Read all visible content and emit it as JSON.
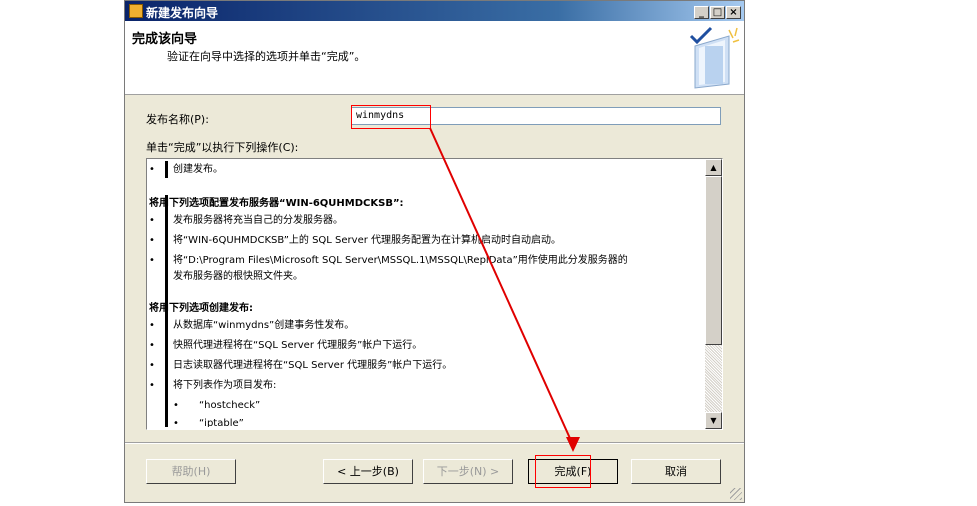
{
  "window": {
    "title": "新建发布向导",
    "controls": {
      "minimize": "_",
      "maximize": "□",
      "close": "×"
    }
  },
  "header": {
    "title": "完成该向导",
    "subtitle": "验证在向导中选择的选项并单击“完成”。"
  },
  "publication_name": {
    "label": "发布名称(P):",
    "value": "winmydns"
  },
  "actions_label": "单击“完成”以执行下列操作(C):",
  "summary": {
    "create_bullet": "•",
    "create": "创建发布。",
    "config_heading": "将用下列选项配置发布服务器“WIN-6QUHMDCKSB”:",
    "config_items": [
      "发布服务器将充当自己的分发服务器。",
      "将“WIN-6QUHMDCKSB”上的 SQL Server 代理服务配置为在计算机启动时自动启动。",
      "将“D:\\Program Files\\Microsoft SQL Server\\MSSQL.1\\MSSQL\\ReplData”用作使用此分发服务器的",
      "发布服务器的根快照文件夹。"
    ],
    "create_heading": "将用下列选项创建发布:",
    "create_items": [
      "从数据库“winmydns”创建事务性发布。",
      "快照代理进程将在“SQL Server 代理服务”帐户下运行。",
      "日志读取器代理进程将在“SQL Server 代理服务”帐户下运行。",
      "将下列表作为项目发布:"
    ],
    "tables": [
      "“hostcheck”",
      "“iptable”"
    ]
  },
  "buttons": {
    "help": "帮助(H)",
    "back": "< 上一步(B)",
    "next": "下一步(N) >",
    "finish": "完成(F)",
    "cancel": "取消"
  },
  "colors": {
    "annotation_red": "#ff0000",
    "titlebar_start": "#0a246a"
  }
}
